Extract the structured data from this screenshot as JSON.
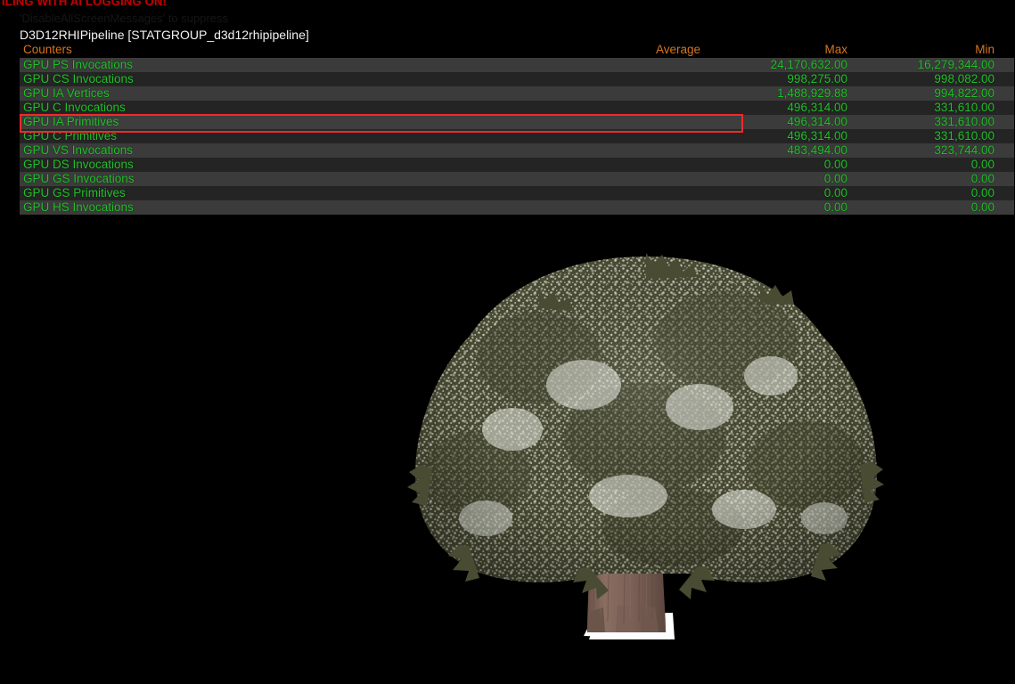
{
  "overlay": {
    "warning_line": "ILING WITH AI LOGGING ON!",
    "suppress_hint": "'DisableAllScreenMessages' to suppress",
    "stat_group_title": "D3D12RHIPipeline [STATGROUP_d3d12rhipipeline]"
  },
  "stats_table": {
    "columns": [
      "Counters",
      "Average",
      "Max",
      "Min"
    ],
    "rows": [
      {
        "name": "GPU PS Invocations",
        "average": "",
        "max": "24,170,632.00",
        "min": "16,279,344.00",
        "highlighted": false
      },
      {
        "name": "GPU CS Invocations",
        "average": "",
        "max": "998,275.00",
        "min": "998,082.00",
        "highlighted": false
      },
      {
        "name": "GPU IA Vertices",
        "average": "",
        "max": "1,488,929.88",
        "min": "994,822.00",
        "highlighted": false
      },
      {
        "name": "GPU C Invocations",
        "average": "",
        "max": "496,314.00",
        "min": "331,610.00",
        "highlighted": false
      },
      {
        "name": "GPU IA Primitives",
        "average": "",
        "max": "496,314.00",
        "min": "331,610.00",
        "highlighted": true
      },
      {
        "name": "GPU C Primitives",
        "average": "",
        "max": "496,314.00",
        "min": "331,610.00",
        "highlighted": false
      },
      {
        "name": "GPU VS Invocations",
        "average": "",
        "max": "483,494.00",
        "min": "323,744.00",
        "highlighted": false
      },
      {
        "name": "GPU DS Invocations",
        "average": "",
        "max": "0.00",
        "min": "0.00",
        "highlighted": false
      },
      {
        "name": "GPU GS Invocations",
        "average": "",
        "max": "0.00",
        "min": "0.00",
        "highlighted": false
      },
      {
        "name": "GPU GS Primitives",
        "average": "",
        "max": "0.00",
        "min": "0.00",
        "highlighted": false
      },
      {
        "name": "GPU HS Invocations",
        "average": "",
        "max": "0.00",
        "min": "0.00",
        "highlighted": false
      }
    ]
  },
  "colors": {
    "background": "#000000",
    "warning_text": "#c00000",
    "header_text": "#d4761e",
    "stat_value_text": "#22c12a",
    "title_text": "#f2f2f2",
    "row_light": "#3b3b3b",
    "row_dark": "#242424",
    "highlight_border": "#ee2b2b",
    "foliage_dark": "#494b33",
    "foliage_light": "#cfd2c5",
    "trunk": "#7d6258",
    "ground_patch": "#ffffff"
  },
  "scene": {
    "object_name": "tree-mesh",
    "description": "foliage-canopy-and-trunk"
  }
}
